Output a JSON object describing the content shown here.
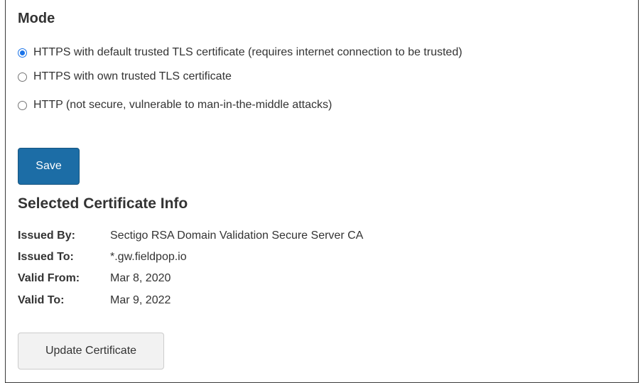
{
  "mode": {
    "heading": "Mode",
    "options": [
      {
        "label": "HTTPS with default trusted TLS certificate (requires internet connection to be trusted)",
        "selected": true
      },
      {
        "label": "HTTPS with own trusted TLS certificate",
        "selected": false
      },
      {
        "label": "HTTP (not secure, vulnerable to man-in-the-middle attacks)",
        "selected": false
      }
    ],
    "save_label": "Save"
  },
  "certificate": {
    "heading": "Selected Certificate Info",
    "issued_by_label": "Issued By:",
    "issued_by": "Sectigo RSA Domain Validation Secure Server CA",
    "issued_to_label": "Issued To:",
    "issued_to": "*.gw.fieldpop.io",
    "valid_from_label": "Valid From:",
    "valid_from": "Mar 8, 2020",
    "valid_to_label": "Valid To:",
    "valid_to": "Mar 9, 2022",
    "update_label": "Update Certificate"
  },
  "colors": {
    "primary_button": "#1c6da6",
    "radio_accent": "#1a73e8",
    "secondary_button": "#f2f2f2",
    "text": "#333333"
  }
}
